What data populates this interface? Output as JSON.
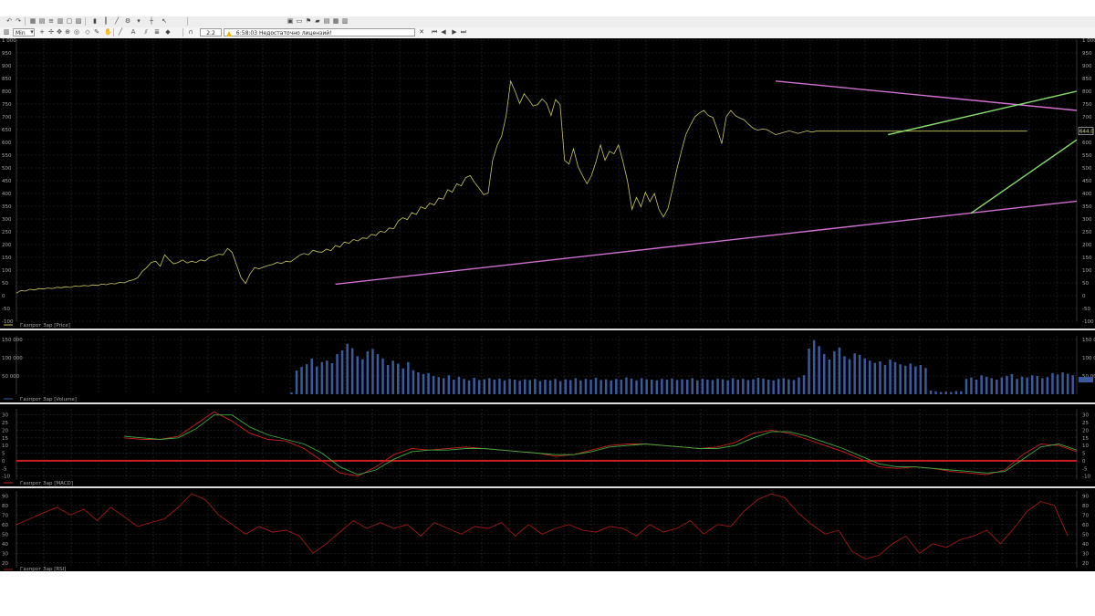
{
  "toolbar": {
    "interval_value": "Min",
    "field_value": "2.2",
    "status_time": "6:58:03",
    "status_message": "Недостаточно лицензий!"
  },
  "colors": {
    "background": "#000000",
    "grid": "#2e2e2e",
    "axis_text": "#a8a8a8",
    "price_line": "#c8c860",
    "volume_bars": "#3a5a9e",
    "macd_red": "#cc1f1f",
    "macd_green": "#3fae3f",
    "rsi_line": "#a01818",
    "trend_pink": "#d070d0",
    "trend_green": "#88e070",
    "panel_divider": "#dcdcdc"
  },
  "chart_data": [
    {
      "type": "line",
      "panel": "price",
      "legend": "Газпрот Зар [Price]",
      "price_badge": "644.0",
      "yticks": [
        "1 000",
        "950",
        "900",
        "850",
        "800",
        "750",
        "700",
        "650",
        "600",
        "550",
        "500",
        "450",
        "400",
        "350",
        "300",
        "250",
        "200",
        "150",
        "100",
        "50",
        "0",
        "-50",
        "-100"
      ],
      "ylim": [
        -100,
        1000
      ],
      "x": [
        0,
        5,
        10,
        15,
        20,
        25,
        30,
        35,
        40,
        45,
        50,
        55,
        60,
        65,
        70,
        75,
        80,
        85,
        90,
        95,
        100,
        105,
        110,
        115,
        120,
        125,
        130,
        135,
        140,
        145,
        150,
        155,
        160,
        165,
        170,
        175,
        180,
        185,
        190,
        195,
        200,
        205,
        210,
        215,
        220,
        225,
        230,
        235,
        240,
        245,
        250,
        255,
        260,
        265,
        270,
        275,
        280,
        285,
        290,
        295,
        300,
        305,
        310,
        315,
        320,
        325,
        330,
        335,
        340,
        345,
        350,
        355,
        360,
        365,
        370,
        375,
        380,
        385,
        390,
        395,
        400,
        405,
        410,
        415,
        420,
        425,
        430,
        435,
        440,
        445,
        450,
        455,
        460,
        465,
        470,
        475,
        480,
        485,
        490,
        495,
        500,
        505,
        510,
        515,
        520,
        525,
        530,
        535,
        540,
        545,
        550,
        555,
        560,
        565,
        570,
        575,
        580,
        585,
        590,
        595,
        600,
        605,
        610,
        615,
        620,
        625,
        630,
        635,
        640,
        645,
        650,
        655,
        660,
        665,
        670,
        675,
        680,
        685,
        690,
        695,
        700,
        705,
        710,
        715,
        720,
        725,
        730,
        735,
        740,
        745,
        750,
        755,
        760,
        765,
        770,
        775,
        780,
        785,
        790,
        795,
        800,
        805,
        810,
        815,
        820,
        825,
        830,
        835,
        840,
        845,
        850,
        855,
        860,
        865,
        870,
        875,
        880,
        885,
        890,
        895,
        900,
        905,
        910,
        915,
        920,
        925,
        930,
        935,
        940,
        945,
        950,
        955,
        960,
        965,
        970,
        975,
        980,
        985,
        990,
        995,
        1000,
        1005,
        1010,
        1015,
        1020,
        1025,
        1030,
        1035,
        1040,
        1045,
        1050,
        1055,
        1060,
        1065,
        1070,
        1075,
        1080,
        1085,
        1090,
        1095,
        1100,
        1105,
        1110,
        1115,
        1120,
        1125,
        1130,
        1135,
        1140,
        1145,
        1150,
        1155,
        1160,
        1165,
        1170,
        1175,
        1180
      ],
      "series": [
        {
          "values": [
            10,
            20,
            18,
            25,
            22,
            28,
            26,
            30,
            28,
            33,
            31,
            35,
            32,
            38,
            36,
            40,
            38,
            42,
            40,
            45,
            43,
            48,
            46,
            52,
            50,
            58,
            62,
            70,
            95,
            110,
            130,
            135,
            115,
            160,
            140,
            125,
            130,
            140,
            128,
            135,
            130,
            140,
            136,
            150,
            155,
            162,
            160,
            185,
            170,
            120,
            70,
            48,
            85,
            110,
            105,
            112,
            118,
            122,
            130,
            126,
            135,
            132,
            145,
            158,
            165,
            160,
            178,
            172,
            170,
            182,
            176,
            196,
            190,
            210,
            205,
            220,
            214,
            226,
            224,
            240,
            236,
            252,
            248,
            265,
            262,
            292,
            305,
            298,
            325,
            318,
            348,
            340,
            362,
            355,
            382,
            378,
            415,
            405,
            438,
            430,
            462,
            470,
            442,
            420,
            395,
            402,
            530,
            588,
            625,
            705,
            840,
            800,
            752,
            790,
            768,
            742,
            748,
            770,
            752,
            705,
            768,
            748,
            530,
            515,
            575,
            505,
            470,
            438,
            470,
            525,
            590,
            530,
            565,
            555,
            590,
            525,
            450,
            338,
            385,
            348,
            405,
            368,
            400,
            338,
            308,
            340,
            415,
            495,
            565,
            630,
            668,
            700,
            715,
            725,
            705,
            698,
            650,
            595,
            700,
            725,
            705,
            695,
            688,
            670,
            655,
            648,
            652,
            650,
            640,
            630,
            635,
            640,
            645,
            640,
            635,
            640,
            645,
            640,
            644,
            644,
            644,
            644,
            644,
            644,
            644,
            644,
            644,
            644,
            644,
            644,
            644,
            644,
            644,
            644,
            644,
            644,
            644,
            644,
            644,
            644,
            644,
            644,
            644,
            644,
            644,
            644,
            644,
            644,
            644,
            644,
            644,
            644,
            644,
            644,
            644,
            644,
            644,
            644,
            644,
            644,
            644,
            644,
            644,
            644,
            644,
            644
          ]
        }
      ]
    },
    {
      "type": "bar",
      "panel": "volume",
      "legend": "Газпрот Зар [Volume]",
      "yticks_left": [
        "150 000",
        "100 000",
        "50 000"
      ],
      "yticks_right": [
        "150 000",
        "100 000",
        "50 000"
      ],
      "ylim": [
        0,
        160000
      ],
      "series": [
        {
          "values": [
            0,
            0,
            0,
            0,
            0,
            0,
            0,
            0,
            0,
            0,
            0,
            0,
            0,
            0,
            0,
            0,
            0,
            0,
            0,
            0,
            0,
            0,
            0,
            0,
            0,
            0,
            0,
            0,
            0,
            0,
            0,
            0,
            0,
            0,
            0,
            0,
            0,
            0,
            0,
            0,
            0,
            0,
            0,
            0,
            0,
            0,
            0,
            0,
            0,
            0,
            0,
            0,
            0,
            0,
            5000,
            65000,
            75000,
            82000,
            98000,
            76000,
            88000,
            92000,
            85000,
            110000,
            120000,
            138000,
            126000,
            104000,
            96000,
            118000,
            124000,
            110000,
            98000,
            80000,
            92000,
            84000,
            71000,
            88000,
            66000,
            60000,
            55000,
            58000,
            50000,
            47000,
            44000,
            52000,
            40000,
            48000,
            42000,
            38000,
            45000,
            39000,
            41000,
            44000,
            40000,
            43000,
            38000,
            42000,
            40000,
            37000,
            41000,
            39000,
            42000,
            36000,
            40000,
            38000,
            42000,
            36000,
            41000,
            39000,
            44000,
            38000,
            42000,
            40000,
            45000,
            39000,
            41000,
            38000,
            42000,
            40000,
            46000,
            43000,
            38000,
            44000,
            41000,
            40000,
            38000,
            42000,
            40000,
            43000,
            39000,
            41000,
            40000,
            44000,
            38000,
            42000,
            40000,
            39000,
            43000,
            41000,
            38000,
            44000,
            40000,
            42000,
            39000,
            41000,
            45000,
            43000,
            40000,
            38000,
            42000,
            44000,
            41000,
            39000,
            46000,
            52000,
            125000,
            148000,
            132000,
            110000,
            95000,
            118000,
            128000,
            104000,
            96000,
            112000,
            108000,
            98000,
            92000,
            86000,
            90000,
            80000,
            95000,
            88000,
            82000,
            78000,
            84000,
            76000,
            80000,
            72000,
            10000,
            8000,
            6000,
            7000,
            6000,
            9000,
            8000,
            42000,
            46000,
            40000,
            52000,
            48000,
            44000,
            40000,
            46000,
            50000,
            55000,
            42000,
            48000,
            46000,
            52000,
            50000,
            44000,
            47000,
            58000,
            54000,
            60000,
            56000,
            52000
          ]
        }
      ]
    },
    {
      "type": "line",
      "panel": "macd",
      "legend": "Газпрот Зар [MACD]",
      "yticks": [
        "30",
        "25",
        "20",
        "15",
        "10",
        "5",
        "0",
        "-5",
        "-10"
      ],
      "ylim": [
        -12,
        34
      ],
      "x": [
        0,
        20,
        40,
        60,
        80,
        100,
        120,
        140,
        160,
        180,
        200,
        220,
        240,
        260,
        280,
        300,
        320,
        340,
        360,
        380,
        400,
        420,
        440,
        460,
        480,
        500,
        520,
        540,
        560,
        580,
        600,
        620,
        640,
        660,
        680,
        700,
        720,
        740,
        760,
        780,
        800,
        820,
        840,
        860,
        880,
        900,
        920,
        940,
        960,
        980,
        1000,
        1020,
        1040,
        1060,
        1080,
        1100,
        1120,
        1140,
        1160,
        1180
      ],
      "series": [
        {
          "name": "",
          "values": [
            null,
            null,
            null,
            null,
            null,
            null,
            15,
            14,
            14,
            16,
            24,
            32,
            26,
            18,
            14,
            13,
            8,
            0,
            -8,
            -10,
            -4,
            4,
            8,
            7,
            8,
            9,
            8,
            7,
            6,
            5,
            3,
            4,
            7,
            10,
            11,
            11,
            10,
            9,
            8,
            9,
            12,
            18,
            20,
            18,
            14,
            10,
            6,
            1,
            -4,
            -5,
            -4,
            -5,
            -7,
            -8,
            -9,
            -6,
            4,
            11,
            10,
            6
          ]
        },
        {
          "name": "",
          "values": [
            null,
            null,
            null,
            null,
            null,
            null,
            16,
            15,
            14,
            15,
            21,
            30,
            30,
            22,
            17,
            14,
            11,
            5,
            -4,
            -9,
            -6,
            1,
            6,
            7,
            7,
            8,
            8,
            7,
            6,
            5,
            4,
            4,
            6,
            9,
            10,
            11,
            10,
            9,
            8,
            8,
            10,
            15,
            19,
            19,
            16,
            12,
            8,
            3,
            -2,
            -4,
            -4,
            -5,
            -6,
            -7,
            -8,
            -7,
            1,
            9,
            11,
            7
          ]
        }
      ]
    },
    {
      "type": "line",
      "panel": "rsi",
      "legend": "Газпрот Зар [RSI]",
      "yticks": [
        "90",
        "80",
        "70",
        "60",
        "50",
        "40",
        "30",
        "20"
      ],
      "ylim": [
        15,
        95
      ],
      "x": [
        0,
        15,
        30,
        45,
        60,
        75,
        90,
        105,
        120,
        135,
        150,
        165,
        180,
        195,
        210,
        225,
        240,
        255,
        270,
        285,
        300,
        315,
        330,
        345,
        360,
        375,
        390,
        405,
        420,
        435,
        450,
        465,
        480,
        495,
        510,
        525,
        540,
        555,
        570,
        585,
        600,
        615,
        630,
        645,
        660,
        675,
        690,
        705,
        720,
        735,
        750,
        765,
        780,
        795,
        810,
        825,
        840,
        855,
        870,
        885,
        900,
        915,
        930,
        945,
        960,
        975,
        990,
        1005,
        1020,
        1035,
        1050,
        1065,
        1080,
        1095,
        1110,
        1125,
        1140,
        1155,
        1170,
        1185
      ],
      "series": [
        {
          "values": [
            60,
            66,
            72,
            78,
            70,
            76,
            64,
            78,
            68,
            58,
            62,
            66,
            78,
            92,
            86,
            70,
            60,
            50,
            58,
            52,
            54,
            48,
            30,
            40,
            52,
            64,
            56,
            62,
            56,
            60,
            48,
            62,
            56,
            50,
            58,
            56,
            62,
            48,
            60,
            50,
            56,
            60,
            54,
            52,
            58,
            56,
            48,
            60,
            52,
            56,
            64,
            50,
            60,
            58,
            74,
            86,
            92,
            88,
            72,
            60,
            50,
            54,
            32,
            24,
            28,
            40,
            48,
            30,
            40,
            36,
            44,
            48,
            54,
            40,
            56,
            74,
            84,
            80,
            48,
            52
          ]
        }
      ]
    }
  ],
  "trendlines": [
    {
      "name": "pink-top",
      "color": "pink",
      "from": [
        845,
        840
      ],
      "to": [
        1180,
        725
      ]
    },
    {
      "name": "pink-bottom",
      "color": "pink",
      "from": [
        355,
        45
      ],
      "to": [
        1180,
        370
      ]
    },
    {
      "name": "green-top",
      "color": "green",
      "from": [
        970,
        630
      ],
      "to": [
        1180,
        800
      ]
    },
    {
      "name": "green-bottom",
      "color": "green",
      "from": [
        1062,
        322
      ],
      "to": [
        1180,
        610
      ]
    }
  ],
  "price_xrange": [
    0,
    1180
  ],
  "macd_zero_line": 0
}
